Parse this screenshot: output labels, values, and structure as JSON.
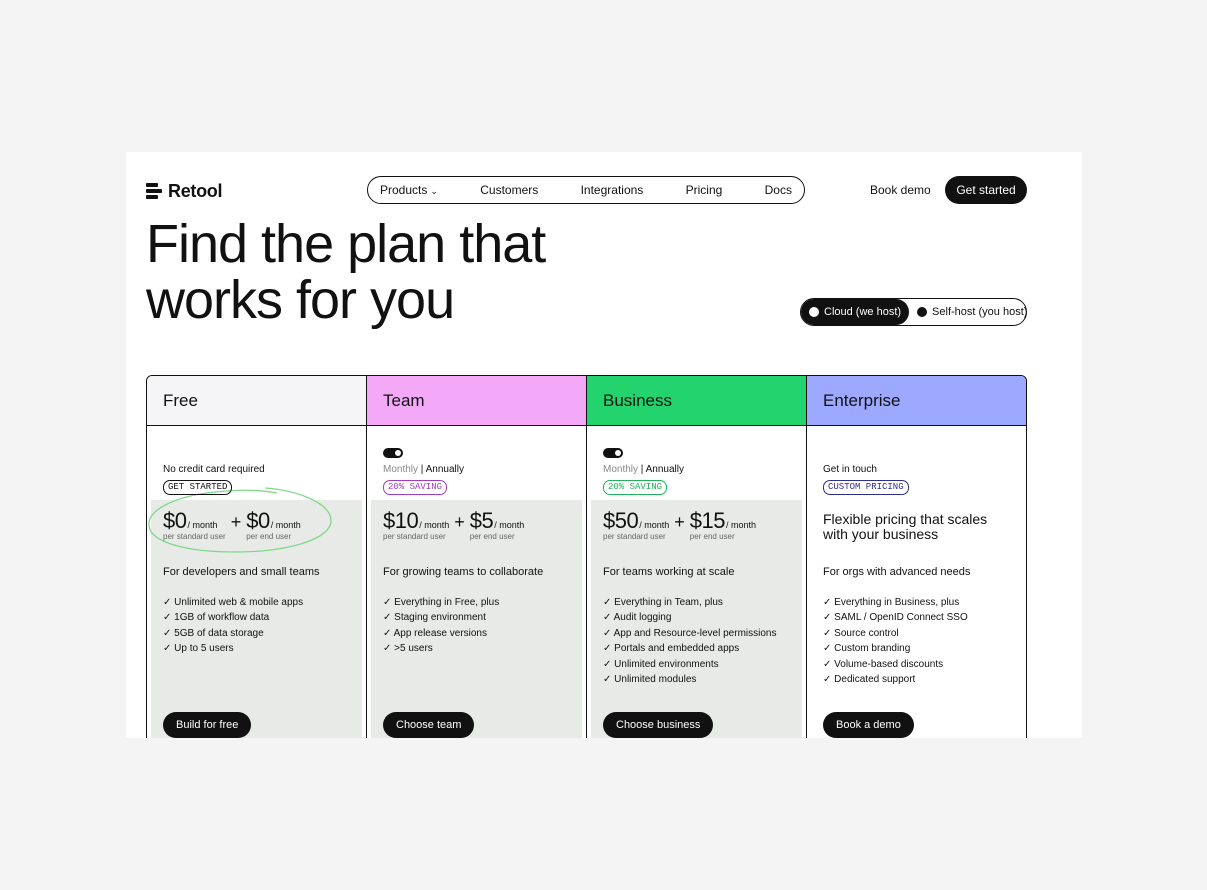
{
  "nav": {
    "brand": "Retool",
    "items": [
      "Products",
      "Customers",
      "Integrations",
      "Pricing",
      "Docs"
    ],
    "book_demo": "Book demo",
    "get_started": "Get started"
  },
  "hero": {
    "line1": "Find the plan that",
    "line2": "works for you"
  },
  "hosting": {
    "cloud": "Cloud (we host)",
    "self": "Self-host (you host)",
    "selected": "cloud"
  },
  "plans": [
    {
      "name": "Free",
      "header_color": "#f5f5f7",
      "note": "No credit card required",
      "badge": "GET STARTED",
      "price_a": "$0",
      "unit_a": "/ month",
      "caption_a": "per standard user",
      "price_b": "$0",
      "unit_b": "/ month",
      "caption_b": "per end user",
      "tagline": "For developers and small teams",
      "features": [
        "✓ Unlimited web & mobile apps",
        "✓ 1GB of workflow data",
        "✓ 5GB of data storage",
        "✓ Up to 5 users"
      ],
      "cta": "Build for free"
    },
    {
      "name": "Team",
      "header_color": "#f3a8f8",
      "billing_monthly": "Monthly",
      "billing_sep": " | ",
      "billing_annually": "Annually",
      "badge": "20% SAVING",
      "price_a": "$10",
      "unit_a": "/ month",
      "caption_a": "per standard user",
      "price_b": "$5",
      "unit_b": "/ month",
      "caption_b": "per end user",
      "tagline": "For growing teams to collaborate",
      "features": [
        "✓ Everything in Free, plus",
        "✓ Staging environment",
        "✓ App release versions",
        "✓ >5 users"
      ],
      "cta": "Choose team"
    },
    {
      "name": "Business",
      "header_color": "#22d36e",
      "billing_monthly": "Monthly",
      "billing_sep": " | ",
      "billing_annually": "Annually",
      "badge": "20% SAVING",
      "price_a": "$50",
      "unit_a": "/ month",
      "caption_a": "per standard user",
      "price_b": "$15",
      "unit_b": "/ month",
      "caption_b": "per end user",
      "tagline": "For teams working at scale",
      "features": [
        "✓ Everything in Team, plus",
        "✓ Audit logging",
        "✓ App and Resource-level permissions",
        "✓ Portals and embedded apps",
        "✓ Unlimited environments",
        "✓ Unlimited modules"
      ],
      "cta": "Choose business"
    },
    {
      "name": "Enterprise",
      "header_color": "#9da8ff",
      "note": "Get in touch",
      "badge": "CUSTOM PRICING",
      "flex_text": "Flexible pricing that scales with your business",
      "tagline": "For orgs with advanced needs",
      "features": [
        "✓ Everything in Business, plus",
        "✓ SAML / OpenID Connect SSO",
        "✓ Source control",
        "✓ Custom branding",
        "✓ Volume-based discounts",
        "✓ Dedicated support"
      ],
      "cta": "Book a demo"
    }
  ],
  "colors": {
    "ink": "#111111",
    "panel_shade": "#e8eae7",
    "scribble": "#7fd98a"
  }
}
